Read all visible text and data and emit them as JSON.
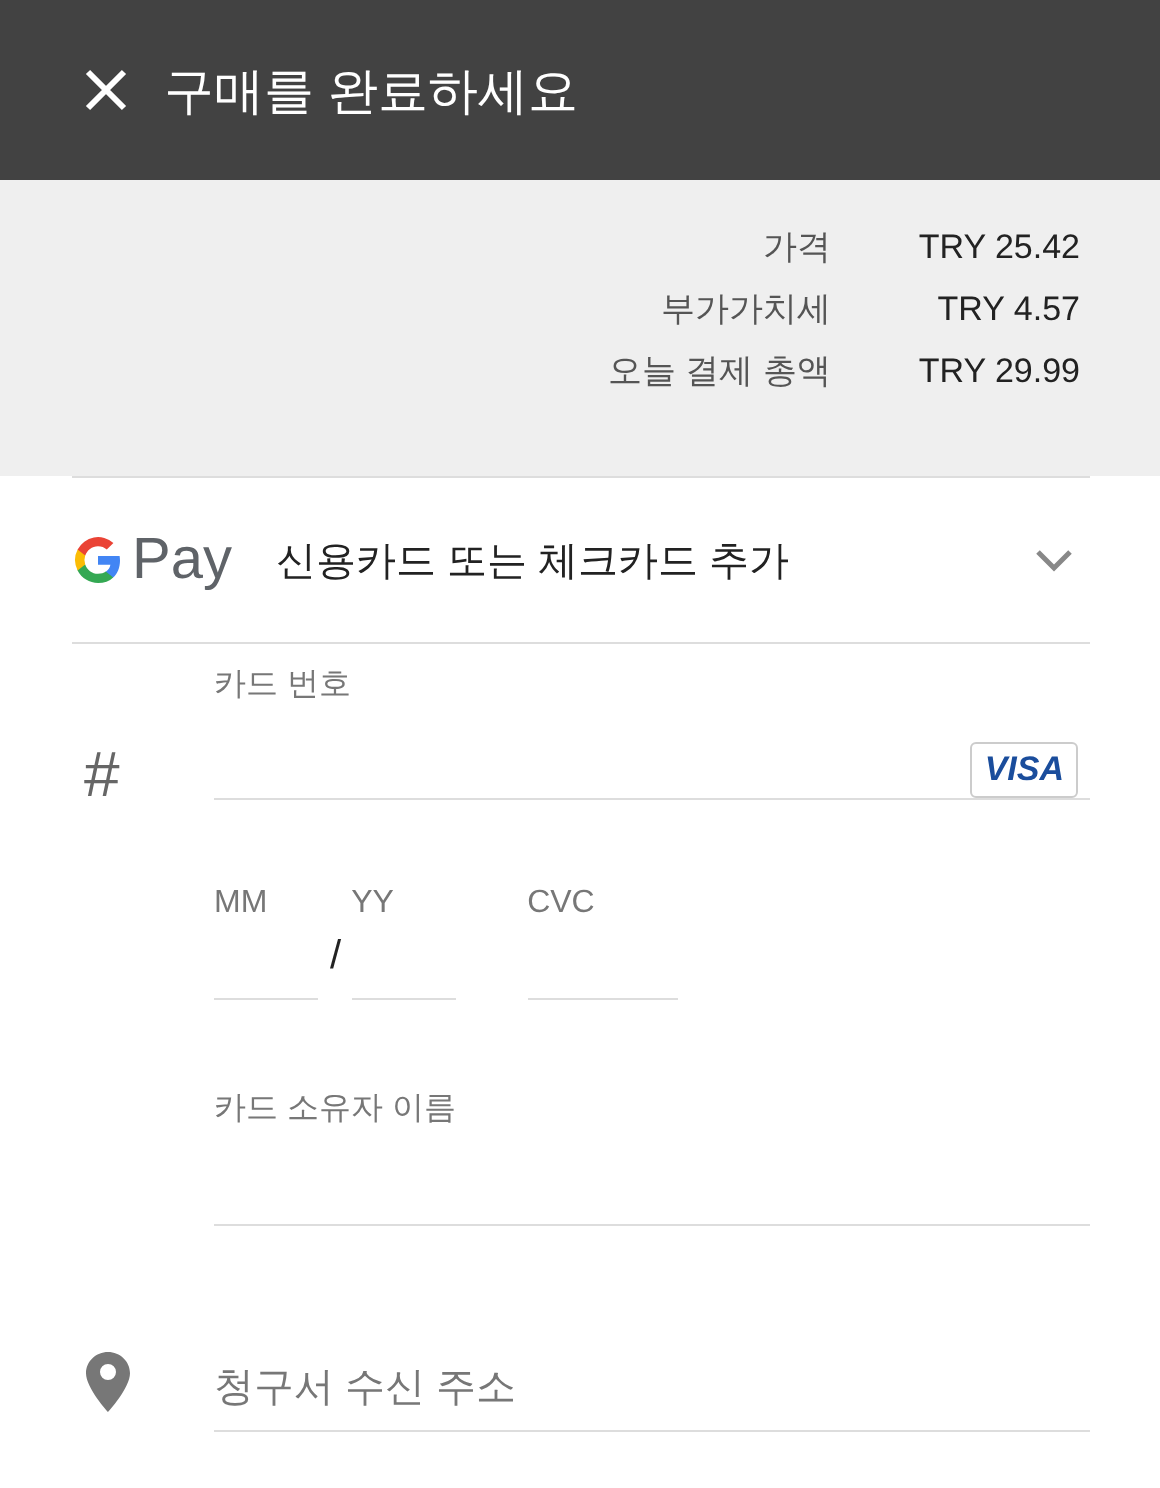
{
  "header": {
    "title": "구매를 완료하세요"
  },
  "summary": [
    {
      "label": "가격",
      "value": "TRY 25.42"
    },
    {
      "label": "부가가치세",
      "value": "TRY 4.57"
    },
    {
      "label": "오늘 결제 총액",
      "value": "TRY 29.99"
    }
  ],
  "payment_method": {
    "brand": "Pay",
    "label": "신용카드 또는 체크카드 추가",
    "expanded": false
  },
  "card_form": {
    "card_number": {
      "icon_text": "#",
      "label": "카드 번호",
      "card_badge": "VISA"
    },
    "expiry_month": {
      "label": "MM"
    },
    "separator": "/",
    "expiry_year": {
      "label": "YY"
    },
    "cvc": {
      "label": "CVC"
    },
    "cardholder_name": {
      "label": "카드 소유자 이름"
    },
    "billing_address": {
      "placeholder": "청구서 수신 주소"
    }
  }
}
